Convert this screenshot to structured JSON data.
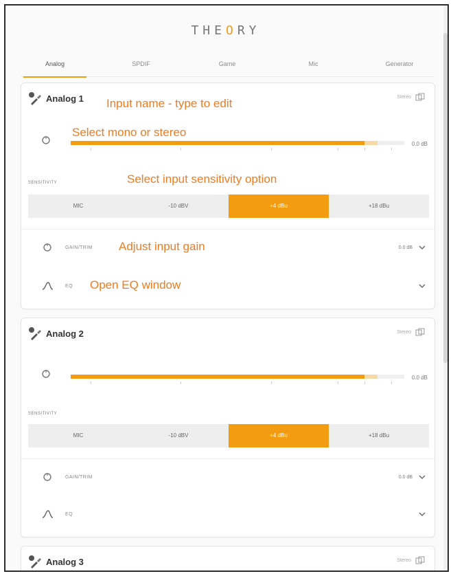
{
  "app": {
    "logo": "THEORY"
  },
  "tabs": [
    "Analog",
    "SPDIF",
    "Game",
    "Mic",
    "Generator"
  ],
  "cards": [
    {
      "name": "Analog 1",
      "link_label": "Stereo",
      "meter_fill": 0.88,
      "meter_peak": 0.92,
      "meter_value": "0.0 dB",
      "sensitivity_label": "SENSITIVITY",
      "sensitivity_options": [
        "MIC",
        "-10 dBV",
        "+4 dBu",
        "+18 dBu"
      ],
      "sensitivity_selected": 2,
      "gain_label": "GAIN/TRIM",
      "gain_value": "0.0 dB",
      "eq_label": "EQ"
    },
    {
      "name": "Analog 2",
      "link_label": "Stereo",
      "meter_fill": 0.88,
      "meter_peak": 0.92,
      "meter_value": "0.0 dB",
      "sensitivity_label": "SENSITIVITY",
      "sensitivity_options": [
        "MIC",
        "-10 dBV",
        "+4 dBu",
        "+18 dBu"
      ],
      "sensitivity_selected": 2,
      "gain_label": "GAIN/TRIM",
      "gain_value": "0.0 dB",
      "eq_label": "EQ"
    },
    {
      "name": "Analog 3",
      "link_label": "Stereo"
    }
  ],
  "annotations": {
    "input_name": "Input name - type to edit",
    "mono_stereo": "Select mono or stereo",
    "sensitivity": "Select input sensitivity option",
    "gain": "Adjust input gain",
    "eq": "Open EQ window"
  },
  "colors": {
    "accent": "#f39c12",
    "annotation": "#f07b1e"
  },
  "icons": {
    "mono": "mono-stereo-icon",
    "gain": "gain-knob-icon",
    "eq": "eq-curve-icon",
    "link": "link-icon"
  }
}
